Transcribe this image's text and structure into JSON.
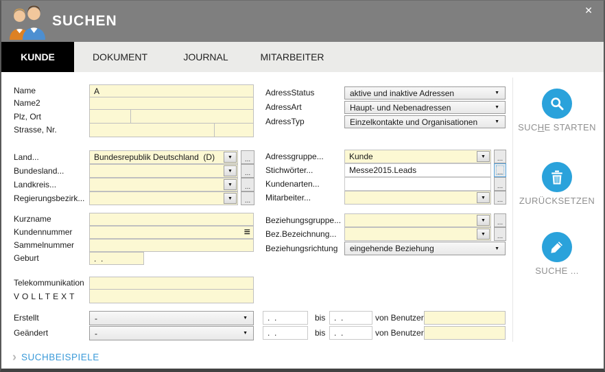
{
  "colors": {
    "accent_blue": "#2AA2DB",
    "header_gray": "#7F7F7F",
    "tab_active_bg": "#000000",
    "field_yellow": "#FCF8D3",
    "link_blue": "#3A9AD9"
  },
  "header": {
    "title": "SUCHEN",
    "close_icon": "✕"
  },
  "tabs": {
    "kunde": "KUNDE",
    "dokument": "DOKUMENT",
    "journal": "JOURNAL",
    "mitarbeiter": "MITARBEITER"
  },
  "left": {
    "name_label": "Name",
    "name_value": "A",
    "name2_label": "Name2",
    "plz_ort_label": "Plz, Ort",
    "strasse_nr_label": "Strasse, Nr.",
    "land_label": "Land...",
    "land_value": "Bundesrepublik Deutschland  (D)",
    "bundesland_label": "Bundesland...",
    "landkreis_label": "Landkreis...",
    "regierungsbezirk_label": "Regierungsbezirk...",
    "kurzname_label": "Kurzname",
    "kundennummer_label": "Kundennummer",
    "sammelnummer_label": "Sammelnummer",
    "geburt_label": "Geburt",
    "telekommunikation_label": "Telekommunikation",
    "volltext_label": "VOLLTEXT",
    "erstellt_label": "Erstellt",
    "erstellt_value": "-",
    "geaendert_label": "Geändert",
    "geaendert_value": "-"
  },
  "right": {
    "adressstatus_label": "AdressStatus",
    "adressstatus_value": "aktive und inaktive Adressen",
    "adressart_label": "AdressArt",
    "adressart_value": "Haupt- und Nebenadressen",
    "adresstyp_label": "AdressTyp",
    "adresstyp_value": "Einzelkontakte und Organisationen",
    "adressgruppe_label": "Adressgruppe...",
    "adressgruppe_value": "Kunde",
    "stichwoerter_label": "Stichwörter...",
    "stichwoerter_value": "Messe2015.Leads",
    "kundenarten_label": "Kundenarten...",
    "mitarbeiter_label": "Mitarbeiter...",
    "beziehungsgruppe_label": "Beziehungsgruppe...",
    "bez_bezeichnung_label": "Bez.Bezeichnung...",
    "beziehungsrichtung_label": "Beziehungsrichtung",
    "beziehungsrichtung_value": "eingehende Beziehung"
  },
  "dates": {
    "placeholder": ".  .",
    "bis_label": "bis",
    "von_benutzer_label": "von Benutzer"
  },
  "actions": {
    "suche_starten_pre": "SUC",
    "suche_starten_key": "H",
    "suche_starten_post": "E STARTEN",
    "zuruecksetzen": "ZURÜCKSETZEN",
    "suche_weitere": "SUCHE ..."
  },
  "footer": {
    "chevron": "›",
    "suchbeispiele": "SUCHBEISPIELE"
  },
  "misc": {
    "dots": "...",
    "arrow": "▼"
  }
}
